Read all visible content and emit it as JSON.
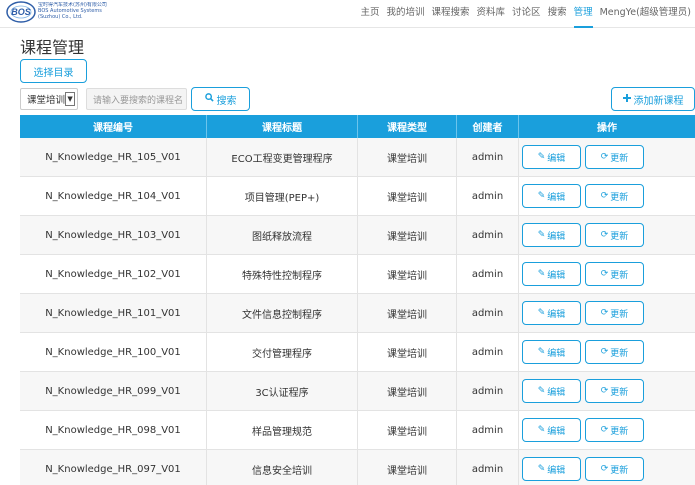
{
  "logo": {
    "badge": "BOS",
    "lines": [
      "宝时得汽车技术(苏州)有限公司",
      "BOS Automotive Systems",
      "(Suzhou) Co., Ltd."
    ]
  },
  "nav": {
    "items": [
      "主页",
      "我的培训",
      "课程搜索",
      "资料库",
      "讨论区",
      "搜索",
      "管理",
      "MengYe(超级管理员)"
    ],
    "active_index": 6
  },
  "page_title": "课程管理",
  "select_dir_label": "选择目录",
  "filter": {
    "selected": "课堂培训"
  },
  "search": {
    "placeholder": "请输入要搜索的课程名",
    "button_label": "搜索"
  },
  "add_button_label": "添加新课程",
  "table": {
    "headers": [
      "课程编号",
      "课程标题",
      "课程类型",
      "创建者",
      "操作"
    ],
    "rows": [
      {
        "id": "N_Knowledge_HR_105_V01",
        "title": "ECO工程变更管理程序",
        "type": "课堂培训",
        "creator": "admin"
      },
      {
        "id": "N_Knowledge_HR_104_V01",
        "title": "项目管理(PEP+)",
        "type": "课堂培训",
        "creator": "admin"
      },
      {
        "id": "N_Knowledge_HR_103_V01",
        "title": "图纸释放流程",
        "type": "课堂培训",
        "creator": "admin"
      },
      {
        "id": "N_Knowledge_HR_102_V01",
        "title": "特殊特性控制程序",
        "type": "课堂培训",
        "creator": "admin"
      },
      {
        "id": "N_Knowledge_HR_101_V01",
        "title": "文件信息控制程序",
        "type": "课堂培训",
        "creator": "admin"
      },
      {
        "id": "N_Knowledge_HR_100_V01",
        "title": "交付管理程序",
        "type": "课堂培训",
        "creator": "admin"
      },
      {
        "id": "N_Knowledge_HR_099_V01",
        "title": "3C认证程序",
        "type": "课堂培训",
        "creator": "admin"
      },
      {
        "id": "N_Knowledge_HR_098_V01",
        "title": "样品管理规范",
        "type": "课堂培训",
        "creator": "admin"
      },
      {
        "id": "N_Knowledge_HR_097_V01",
        "title": "信息安全培训",
        "type": "课堂培训",
        "creator": "admin"
      }
    ],
    "edit_label": "编辑",
    "update_label": "更新"
  },
  "icons": {
    "search": "search-icon",
    "plus": "plus-icon",
    "edit": "pencil-icon",
    "update": "refresh-icon",
    "dropdown": "chevron-down-icon"
  },
  "colors": {
    "accent": "#1a9fdc",
    "logo": "#2f5ea8"
  }
}
